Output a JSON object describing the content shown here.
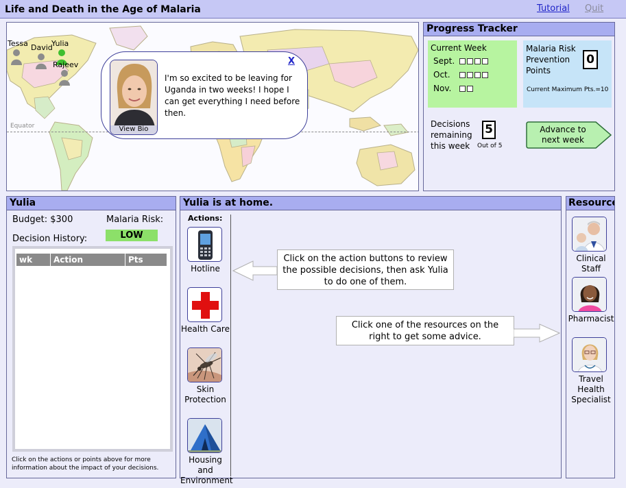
{
  "app": {
    "title": "Life and Death in the Age of Malaria",
    "tutorial_link": "Tutorial",
    "quit_link": "Quit"
  },
  "map": {
    "equator_label": "Equator",
    "people": [
      {
        "name": "Tessa"
      },
      {
        "name": "David"
      },
      {
        "name": "Yulia"
      },
      {
        "name": "Rajeev"
      }
    ],
    "bubble": {
      "close": "X",
      "view_bio": "View Bio",
      "message": "I'm so excited to be leaving for Uganda in two weeks! I hope I can get everything I need before then."
    }
  },
  "progress": {
    "title": "Progress Tracker",
    "current_week_label": "Current Week",
    "months": [
      {
        "label": "Sept.",
        "weeks": 4
      },
      {
        "label": "Oct.",
        "weeks": 4
      },
      {
        "label": "Nov.",
        "weeks": 2
      }
    ],
    "mrpp_label": "Malaria Risk Prevention Points",
    "mrpp_value": "0",
    "max_points": "Current Maximum Pts.=10",
    "decisions_label": "Decisions remaining this week",
    "decisions_value": "5",
    "decisions_outof": "Out of 5",
    "advance_button": "Advance to next week"
  },
  "character": {
    "title": "Yulia",
    "budget": "Budget: $300",
    "risk_label": "Malaria Risk:",
    "risk_value": "LOW",
    "history_label": "Decision History:",
    "history_columns": [
      "wk",
      "Action",
      "Pts"
    ],
    "note": "Click on the actions or points above for more information about the impact of your decisions."
  },
  "home": {
    "title": "Yulia is at home.",
    "actions_label": "Actions:",
    "actions": [
      {
        "label": "Hotline",
        "icon": "phone-icon"
      },
      {
        "label": "Health Care",
        "icon": "red-cross-icon"
      },
      {
        "label": "Skin Protection",
        "icon": "mosquito-icon"
      },
      {
        "label": "Housing and Environment",
        "icon": "tent-icon"
      }
    ],
    "hint_actions": "Click on the action buttons to review the possible decisions, then ask Yulia to do one of them.",
    "hint_resources": "Click one of the resources on the right to get some advice."
  },
  "resources": {
    "title": "Resources",
    "items": [
      {
        "label": "Clinical Staff",
        "icon": "clinical-staff-icon"
      },
      {
        "label": "Pharmacist",
        "icon": "pharmacist-icon"
      },
      {
        "label": "Travel Health Specialist",
        "icon": "travel-health-specialist-icon"
      }
    ]
  },
  "colors": {
    "header_bar": "#a8adf0",
    "title_bar": "#c6c8f5",
    "current_week_bg": "#b7f4a0",
    "mrpp_bg": "#c6e4f8",
    "risk_low": "#8ce069",
    "advance_button": "#b8f0b0",
    "link": "#1f23c8"
  }
}
